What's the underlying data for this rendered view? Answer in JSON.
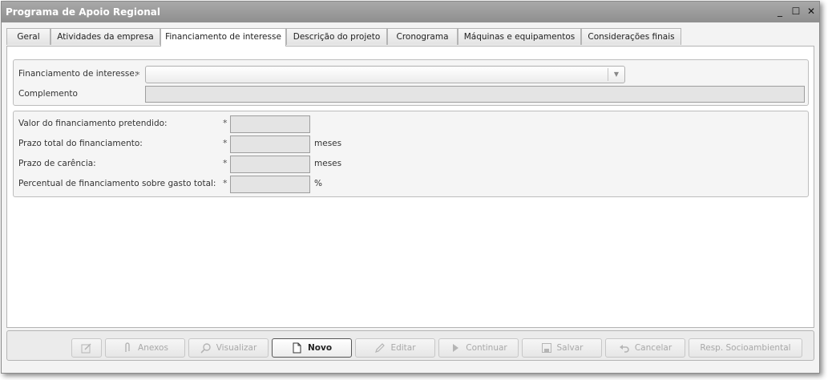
{
  "window": {
    "title": "Programa de Apoio Regional",
    "controls": {
      "minimize": "_",
      "maximize": "☐",
      "close": "✕"
    }
  },
  "tabs": [
    {
      "label": "Geral"
    },
    {
      "label": "Atividades da empresa"
    },
    {
      "label": "Financiamento de interesse",
      "active": true
    },
    {
      "label": "Descrição do projeto"
    },
    {
      "label": "Cronograma"
    },
    {
      "label": "Máquinas e equipamentos"
    },
    {
      "label": "Considerações finais"
    }
  ],
  "form": {
    "required_marker": "*",
    "financiamento_label": "Financiamento de interesse:",
    "financiamento_value": "",
    "complemento_label": "Complemento",
    "complemento_value": "",
    "valor_label": "Valor do financiamento pretendido:",
    "valor_value": "",
    "prazo_total_label": "Prazo total do financiamento:",
    "prazo_total_value": "",
    "prazo_total_unit": "meses",
    "prazo_carencia_label": "Prazo de carência:",
    "prazo_carencia_value": "",
    "prazo_carencia_unit": "meses",
    "percentual_label": "Percentual de financiamento sobre gasto total:",
    "percentual_value": "",
    "percentual_unit": "%"
  },
  "toolbar": {
    "buttons": [
      {
        "label": "",
        "icon": "edit-note-icon",
        "enabled": false
      },
      {
        "label": "Anexos",
        "icon": "paperclip-icon",
        "enabled": false
      },
      {
        "label": "Visualizar",
        "icon": "magnifier-icon",
        "enabled": false
      },
      {
        "label": "Novo",
        "icon": "new-document-icon",
        "enabled": true
      },
      {
        "label": "Editar",
        "icon": "pencil-icon",
        "enabled": false
      },
      {
        "label": "Continuar",
        "icon": "play-icon",
        "enabled": false
      },
      {
        "label": "Salvar",
        "icon": "floppy-disk-icon",
        "enabled": false
      },
      {
        "label": "Cancelar",
        "icon": "undo-icon",
        "enabled": false
      },
      {
        "label": "Resp. Socioambiental",
        "icon": "",
        "enabled": false
      }
    ]
  },
  "colors": {
    "titlebar": "#9a9a9a",
    "field_disabled": "#e4e4e4",
    "window_bg": "#f3f3f3"
  }
}
